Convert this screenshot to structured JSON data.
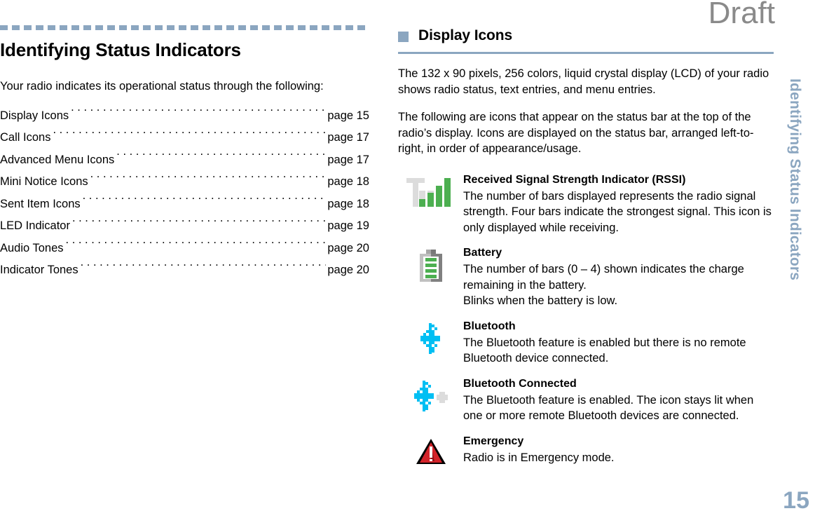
{
  "watermark": "Draft",
  "margin": {
    "tab_title": "Identifying Status Indicators",
    "page_number": "15"
  },
  "colors": {
    "accent": "#8ba6c0",
    "signal_green": "#4caf50",
    "bluetooth_cyan": "#00bff3",
    "emergency_red": "#d3232a",
    "icon_gray": "#dcdcdc",
    "battery_gray": "#808080"
  },
  "left_column": {
    "chapter_title": "Identifying Status Indicators",
    "intro": "Your radio indicates its operational status through the following:",
    "toc": [
      {
        "label": "Display Icons",
        "page": "page 15"
      },
      {
        "label": "Call Icons",
        "page": "page 17"
      },
      {
        "label": "Advanced Menu Icons",
        "page": "page 17"
      },
      {
        "label": "Mini Notice Icons",
        "page": "page 18"
      },
      {
        "label": "Sent Item Icons",
        "page": "page 18"
      },
      {
        "label": "LED Indicator",
        "page": "page 19"
      },
      {
        "label": "Audio Tones",
        "page": "page 20"
      },
      {
        "label": "Indicator Tones",
        "page": "page 20"
      }
    ]
  },
  "right_column": {
    "section_title": "Display Icons",
    "paragraphs": [
      "The  132 x 90 pixels, 256 colors, liquid crystal display (LCD) of your radio shows radio status, text entries, and menu entries.",
      "The following are icons that appear on the status bar at the top of the radio’s display. Icons are displayed on the status bar, arranged left-to-right, in order of appearance/usage."
    ],
    "icons": [
      {
        "icon": "rssi-icon",
        "title": "Received Signal Strength Indicator (RSSI)",
        "lines": [
          "The number of bars displayed represents the radio signal strength. Four bars indicate the strongest signal. This icon is only displayed while receiving."
        ]
      },
      {
        "icon": "battery-icon",
        "title": "Battery",
        "lines": [
          "The number of bars (0 – 4) shown indicates the charge remaining in the battery.",
          "Blinks when the battery is low."
        ]
      },
      {
        "icon": "bluetooth-icon",
        "title": "Bluetooth",
        "lines": [
          "The Bluetooth feature is enabled but there is no remote Bluetooth device connected."
        ]
      },
      {
        "icon": "bluetooth-connected-icon",
        "title": "Bluetooth Connected",
        "lines": [
          "The Bluetooth feature is enabled. The icon stays lit when one or more remote Bluetooth devices are connected."
        ]
      },
      {
        "icon": "emergency-icon",
        "title": "Emergency",
        "lines": [
          "Radio is in Emergency mode."
        ]
      }
    ]
  }
}
